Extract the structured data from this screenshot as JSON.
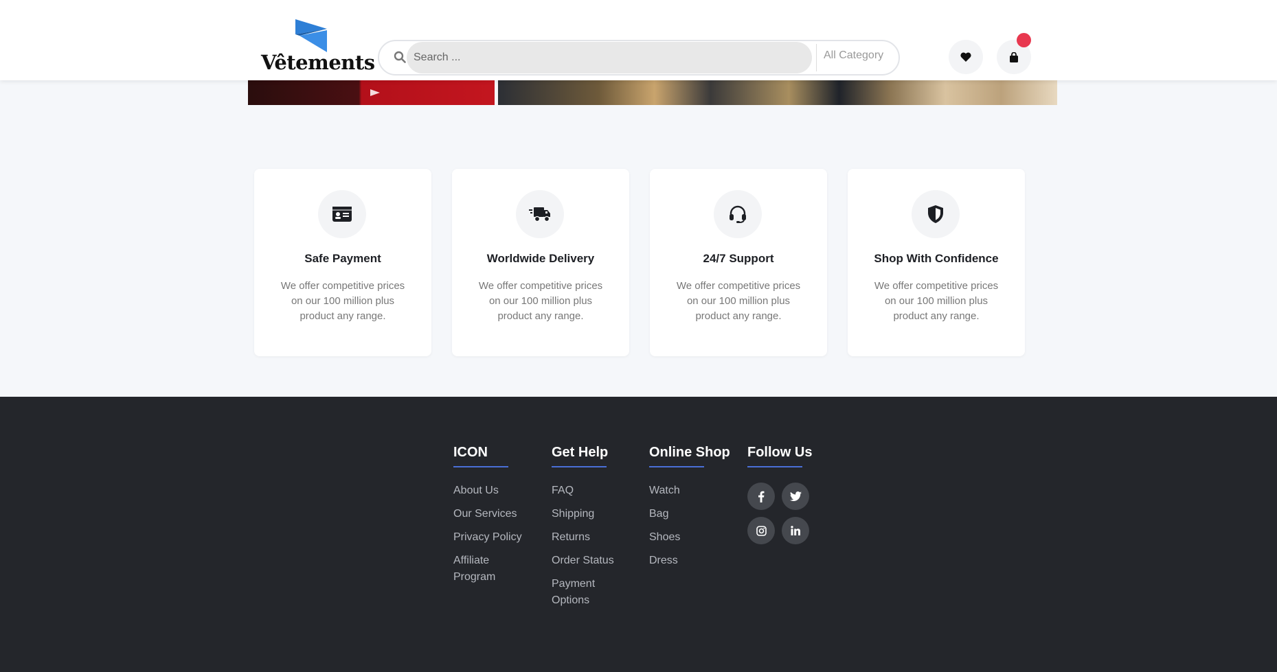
{
  "header": {
    "logo_text": "Vêtements",
    "search_placeholder": "Search ...",
    "category_label": "All Category",
    "wishlist_icon": "heart-icon",
    "cart_icon": "shopping-bag-icon"
  },
  "features": [
    {
      "icon": "id-card-icon",
      "title": "Safe Payment",
      "desc": "We offer competitive prices on our 100 million plus product any range."
    },
    {
      "icon": "truck-icon",
      "title": "Worldwide Delivery",
      "desc": "We offer competitive prices on our 100 million plus product any range."
    },
    {
      "icon": "headset-icon",
      "title": "24/7 Support",
      "desc": "We offer competitive prices on our 100 million plus product any range."
    },
    {
      "icon": "shield-icon",
      "title": "Shop With Confidence",
      "desc": "We offer competitive prices on our 100 million plus product any range."
    }
  ],
  "footer": {
    "col1": {
      "title": "ICON",
      "links": [
        "About Us",
        "Our Services",
        "Privacy Policy",
        "Affiliate Program"
      ]
    },
    "col2": {
      "title": "Get Help",
      "links": [
        "FAQ",
        "Shipping",
        "Returns",
        "Order Status",
        "Payment Options"
      ]
    },
    "col3": {
      "title": "Online Shop",
      "links": [
        "Watch",
        "Bag",
        "Shoes",
        "Dress"
      ]
    },
    "col4": {
      "title": "Follow Us",
      "social": [
        "facebook-icon",
        "twitter-icon",
        "instagram-icon",
        "linkedin-icon"
      ]
    }
  },
  "colors": {
    "accent": "#4a6fd8",
    "badge": "#e8384f",
    "footer_bg": "#24262b",
    "logo_blue": "#2e7fd6"
  }
}
